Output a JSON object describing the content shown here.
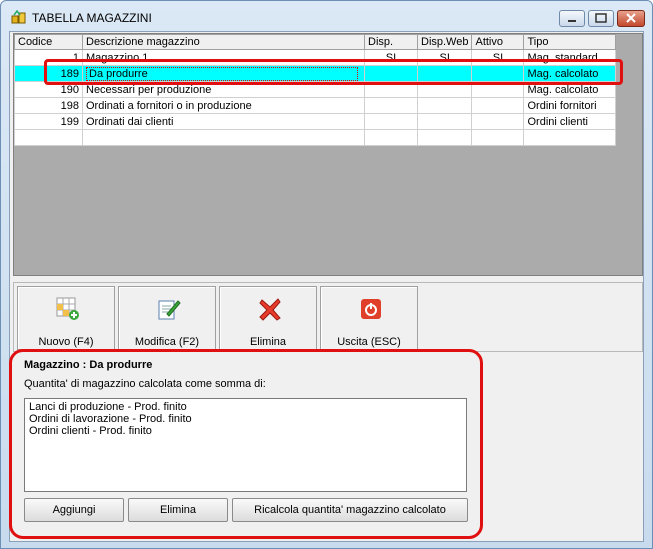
{
  "window": {
    "title": "TABELLA MAGAZZINI"
  },
  "grid": {
    "columns": [
      "Codice",
      "Descrizione magazzino",
      "Disp.",
      "Disp.Web",
      "Attivo",
      "Tipo"
    ],
    "rows": [
      {
        "codice": "1",
        "descrizione": "Magazzino 1",
        "disp": "SI",
        "disp_web": "SI",
        "attivo": "SI",
        "tipo": "Mag. standard"
      },
      {
        "codice": "189",
        "descrizione": "Da produrre",
        "disp": "",
        "disp_web": "",
        "attivo": "",
        "tipo": "Mag. calcolato"
      },
      {
        "codice": "190",
        "descrizione": "Necessari per produzione",
        "disp": "",
        "disp_web": "",
        "attivo": "",
        "tipo": "Mag. calcolato"
      },
      {
        "codice": "198",
        "descrizione": "Ordinati a fornitori o in produzione",
        "disp": "",
        "disp_web": "",
        "attivo": "",
        "tipo": "Ordini fornitori"
      },
      {
        "codice": "199",
        "descrizione": "Ordinati dai clienti",
        "disp": "",
        "disp_web": "",
        "attivo": "",
        "tipo": "Ordini clienti"
      },
      {
        "codice": "",
        "descrizione": "",
        "disp": "",
        "disp_web": "",
        "attivo": "",
        "tipo": ""
      }
    ],
    "selected_row": 1
  },
  "toolbar": {
    "new_label": "Nuovo (F4)",
    "edit_label": "Modifica (F2)",
    "delete_label": "Elimina",
    "exit_label": "Uscita (ESC)"
  },
  "detail": {
    "title": "Magazzino : Da produrre",
    "subtitle": "Quantita' di magazzino calcolata come somma di:",
    "items": [
      "Lanci di produzione - Prod. finito",
      "Ordini di lavorazione - Prod. finito",
      "Ordini clienti - Prod. finito"
    ],
    "add_label": "Aggiungi",
    "remove_label": "Elimina",
    "recalc_label": "Ricalcola quantita' magazzino calcolato"
  },
  "colors": {
    "selection": "#00ffff",
    "highlight": "#e01010"
  },
  "icons": [
    "app-icon",
    "minimize-icon",
    "maximize-icon",
    "close-icon",
    "add-table-icon",
    "edit-icon",
    "delete-x-icon",
    "power-icon"
  ]
}
